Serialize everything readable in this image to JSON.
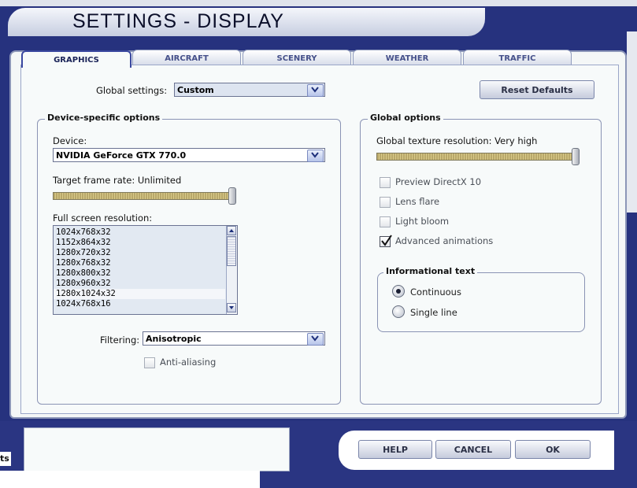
{
  "window": {
    "title": "SETTINGS - DISPLAY"
  },
  "tabs": [
    "GRAPHICS",
    "AIRCRAFT",
    "SCENERY",
    "WEATHER",
    "TRAFFIC"
  ],
  "global_settings": {
    "label": "Global settings:",
    "value": "Custom"
  },
  "reset_defaults": "Reset Defaults",
  "device_group": {
    "title": "Device-specific options",
    "device_label": "Device:",
    "device_value": "NVIDIA GeForce GTX 770.0",
    "frame_rate_label": "Target frame rate: Unlimited",
    "frame_rate_level": 1.0,
    "resolution_label": "Full screen resolution:",
    "resolutions": [
      "1024x768x32",
      "1152x864x32",
      "1280x720x32",
      "1280x768x32",
      "1280x800x32",
      "1280x960x32",
      "1280x1024x32",
      "1024x768x16"
    ],
    "selected_resolution": "1280x1024x32",
    "filtering_label": "Filtering:",
    "filtering_value": "Anisotropic",
    "antialiasing_label": "Anti-aliasing",
    "antialiasing_checked": false
  },
  "global_group": {
    "title": "Global options",
    "texture_label": "Global texture resolution: Very high",
    "texture_level": 1.0,
    "options": [
      {
        "label": "Preview DirectX 10",
        "checked": false
      },
      {
        "label": "Lens flare",
        "checked": false
      },
      {
        "label": "Light bloom",
        "checked": false
      },
      {
        "label": "Advanced animations",
        "checked": true
      }
    ],
    "info_text": {
      "title": "Informational text",
      "options": [
        {
          "label": "Continuous",
          "selected": true
        },
        {
          "label": "Single line",
          "selected": false
        }
      ]
    }
  },
  "buttons": {
    "help": "HELP",
    "cancel": "CANCEL",
    "ok": "OK"
  },
  "bottom_left_text": "ts"
}
